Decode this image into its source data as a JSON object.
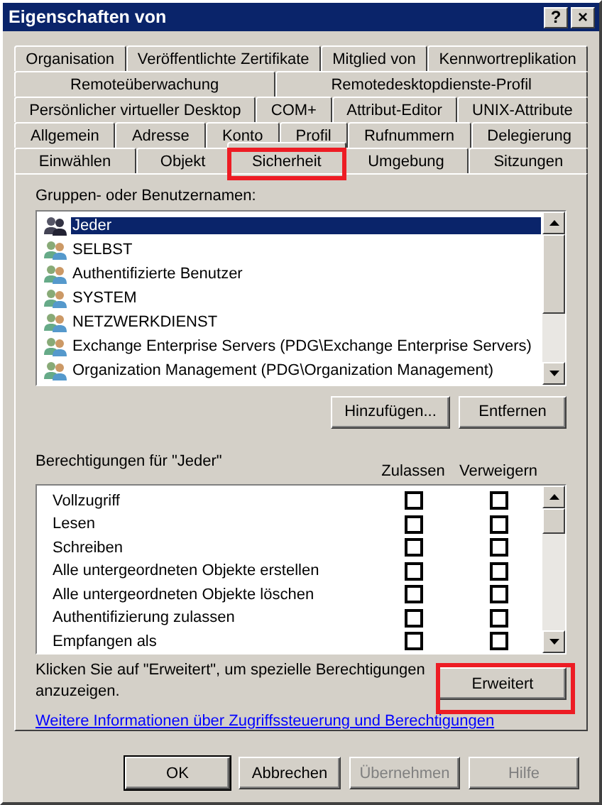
{
  "window": {
    "title": "Eigenschaften von",
    "buttons": [
      "?",
      "×"
    ]
  },
  "tab_rows": [
    [
      {
        "label": "Organisation",
        "selected": false
      },
      {
        "label": "Veröffentlichte Zertifikate",
        "selected": false
      },
      {
        "label": "Mitglied von",
        "selected": false
      },
      {
        "label": "Kennwortreplikation",
        "selected": false
      }
    ],
    [
      {
        "label": "Remoteüberwachung",
        "selected": false
      },
      {
        "label": "Remotedesktopdienste-Profil",
        "selected": false
      }
    ],
    [
      {
        "label": "Persönlicher virtueller Desktop",
        "selected": false
      },
      {
        "label": "COM+",
        "selected": false
      },
      {
        "label": "Attribut-Editor",
        "selected": false
      },
      {
        "label": "UNIX-Attribute",
        "selected": false
      }
    ],
    [
      {
        "label": "Allgemein",
        "selected": false
      },
      {
        "label": "Adresse",
        "selected": false
      },
      {
        "label": "Konto",
        "selected": false
      },
      {
        "label": "Profil",
        "selected": false
      },
      {
        "label": "Rufnummern",
        "selected": false
      },
      {
        "label": "Delegierung",
        "selected": false
      }
    ],
    [
      {
        "label": "Einwählen",
        "selected": false
      },
      {
        "label": "Objekt",
        "selected": false
      },
      {
        "label": "Sicherheit",
        "selected": true
      },
      {
        "label": "Umgebung",
        "selected": false
      },
      {
        "label": "Sitzungen",
        "selected": false
      }
    ]
  ],
  "groups": {
    "label": "Gruppen- oder Benutzernamen:",
    "items": [
      {
        "name": "Jeder",
        "selected": true
      },
      {
        "name": "SELBST",
        "selected": false
      },
      {
        "name": "Authentifizierte Benutzer",
        "selected": false
      },
      {
        "name": "SYSTEM",
        "selected": false
      },
      {
        "name": "NETZWERKDIENST",
        "selected": false
      },
      {
        "name": "Exchange Enterprise Servers (PDG\\Exchange Enterprise Servers)",
        "selected": false
      },
      {
        "name": "Organization Management (PDG\\Organization Management)",
        "selected": false
      }
    ],
    "buttons": [
      "Hinzufügen...",
      "Entfernen"
    ]
  },
  "permissions": {
    "label": "Berechtigungen für \"Jeder\"",
    "columns": [
      "Zulassen",
      "Verweigern"
    ],
    "rows": [
      {
        "name": "Vollzugriff",
        "allow": false,
        "deny": false
      },
      {
        "name": "Lesen",
        "allow": false,
        "deny": false
      },
      {
        "name": "Schreiben",
        "allow": false,
        "deny": false
      },
      {
        "name": "Alle untergeordneten Objekte erstellen",
        "allow": false,
        "deny": false
      },
      {
        "name": "Alle untergeordneten Objekte löschen",
        "allow": false,
        "deny": false
      },
      {
        "name": "Authentifizierung zulassen",
        "allow": false,
        "deny": false
      },
      {
        "name": "Empfangen als",
        "allow": false,
        "deny": false
      }
    ]
  },
  "advanced": {
    "text": "Klicken Sie auf \"Erweitert\", um spezielle Berechtigungen anzuzeigen.",
    "button": "Erweitert"
  },
  "link": "Weitere Informationen über Zugriffssteuerung und Berechtigungen",
  "footer_buttons": [
    {
      "label": "OK",
      "disabled": false,
      "default": true
    },
    {
      "label": "Abbrechen",
      "disabled": false,
      "default": false
    },
    {
      "label": "Übernehmen",
      "disabled": true,
      "default": false
    },
    {
      "label": "Hilfe",
      "disabled": true,
      "default": false
    }
  ],
  "highlight": {
    "selected_tab": true,
    "advanced_button": true
  }
}
